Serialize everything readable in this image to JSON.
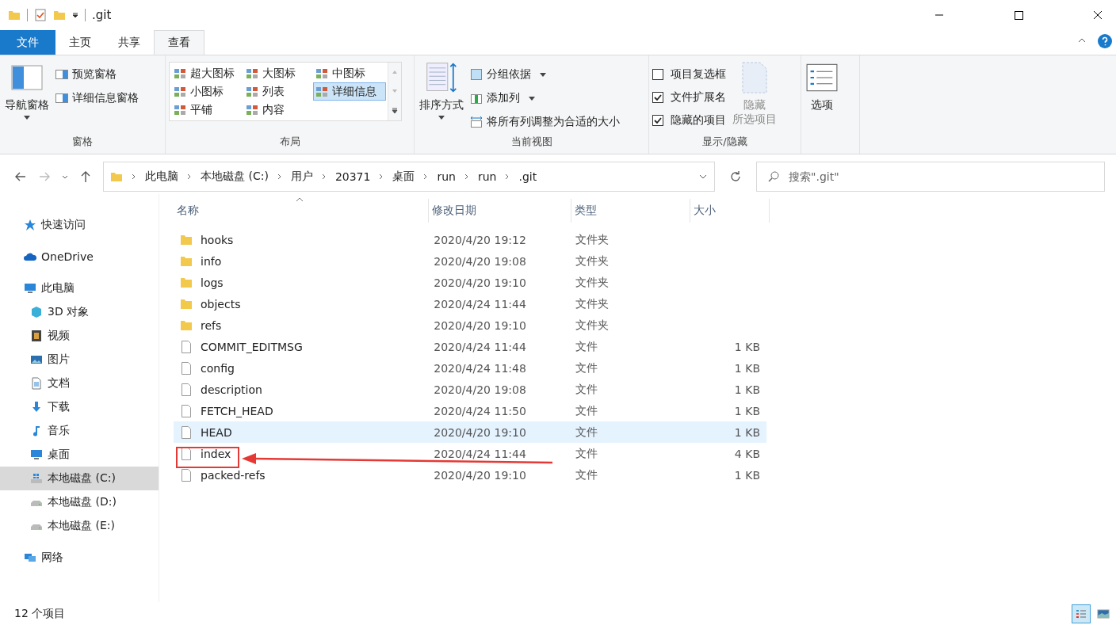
{
  "title_bar": {
    "title": ".git"
  },
  "ribbon_tabs": [
    {
      "label": "文件",
      "kind": "file",
      "selected": false
    },
    {
      "label": "主页",
      "kind": "tab",
      "selected": false
    },
    {
      "label": "共享",
      "kind": "tab",
      "selected": false
    },
    {
      "label": "查看",
      "kind": "tab",
      "selected": true
    }
  ],
  "panes": {
    "label": "窗格",
    "navigation": "导航窗格",
    "items": [
      "预览窗格",
      "详细信息窗格"
    ]
  },
  "layout": {
    "label": "布局",
    "options": [
      {
        "label": "超大图标",
        "selected": false
      },
      {
        "label": "大图标",
        "selected": false
      },
      {
        "label": "中图标",
        "selected": false
      },
      {
        "label": "小图标",
        "selected": false
      },
      {
        "label": "列表",
        "selected": false
      },
      {
        "label": "详细信息",
        "selected": true
      },
      {
        "label": "平铺",
        "selected": false
      },
      {
        "label": "内容",
        "selected": false
      }
    ]
  },
  "current_view": {
    "label": "当前视图",
    "sort": "排序方式",
    "group_by": "分组依据",
    "add_column": "添加列",
    "fit": "将所有列调整为合适的大小"
  },
  "show_hide": {
    "label": "显示/隐藏",
    "checkboxes": [
      {
        "label": "项目复选框",
        "checked": false
      },
      {
        "label": "文件扩展名",
        "checked": true
      },
      {
        "label": "隐藏的项目",
        "checked": true
      }
    ],
    "hide_selected": [
      "隐藏",
      "所选项目"
    ]
  },
  "options": "选项",
  "address": {
    "crumbs": [
      "此电脑",
      "本地磁盘 (C:)",
      "用户",
      "20371",
      "桌面",
      "run",
      "run",
      ".git"
    ],
    "search_placeholder": "搜索\".git\""
  },
  "nav": [
    {
      "label": "快速访问",
      "kind": "star",
      "selected": false
    },
    {
      "label": "OneDrive",
      "kind": "cloud",
      "selected": false
    },
    {
      "label": "此电脑",
      "kind": "pc",
      "selected": false,
      "children": [
        {
          "label": "3D 对象",
          "kind": "cube",
          "selected": false
        },
        {
          "label": "视频",
          "kind": "video",
          "selected": false
        },
        {
          "label": "图片",
          "kind": "picture",
          "selected": false
        },
        {
          "label": "文档",
          "kind": "doc",
          "selected": false
        },
        {
          "label": "下载",
          "kind": "download",
          "selected": false
        },
        {
          "label": "音乐",
          "kind": "music",
          "selected": false
        },
        {
          "label": "桌面",
          "kind": "desktop",
          "selected": false
        },
        {
          "label": "本地磁盘 (C:)",
          "kind": "sysdrive",
          "selected": true
        },
        {
          "label": "本地磁盘 (D:)",
          "kind": "drive",
          "selected": false
        },
        {
          "label": "本地磁盘 (E:)",
          "kind": "drive",
          "selected": false
        }
      ]
    },
    {
      "label": "网络",
      "kind": "network",
      "selected": false
    }
  ],
  "table": {
    "columns": [
      "名称",
      "修改日期",
      "类型",
      "大小"
    ],
    "rows": [
      {
        "name": "hooks",
        "date": "2020/4/20 19:12",
        "type": "文件夹",
        "size": "",
        "kind": "folder",
        "selected": false
      },
      {
        "name": "info",
        "date": "2020/4/20 19:08",
        "type": "文件夹",
        "size": "",
        "kind": "folder",
        "selected": false
      },
      {
        "name": "logs",
        "date": "2020/4/20 19:10",
        "type": "文件夹",
        "size": "",
        "kind": "folder",
        "selected": false
      },
      {
        "name": "objects",
        "date": "2020/4/24 11:44",
        "type": "文件夹",
        "size": "",
        "kind": "folder",
        "selected": false
      },
      {
        "name": "refs",
        "date": "2020/4/20 19:10",
        "type": "文件夹",
        "size": "",
        "kind": "folder",
        "selected": false
      },
      {
        "name": "COMMIT_EDITMSG",
        "date": "2020/4/24 11:44",
        "type": "文件",
        "size": "1 KB",
        "kind": "file",
        "selected": false
      },
      {
        "name": "config",
        "date": "2020/4/24 11:48",
        "type": "文件",
        "size": "1 KB",
        "kind": "file",
        "selected": false
      },
      {
        "name": "description",
        "date": "2020/4/20 19:08",
        "type": "文件",
        "size": "1 KB",
        "kind": "file",
        "selected": false
      },
      {
        "name": "FETCH_HEAD",
        "date": "2020/4/24 11:50",
        "type": "文件",
        "size": "1 KB",
        "kind": "file",
        "selected": false
      },
      {
        "name": "HEAD",
        "date": "2020/4/20 19:10",
        "type": "文件",
        "size": "1 KB",
        "kind": "file",
        "selected": true
      },
      {
        "name": "index",
        "date": "2020/4/24 11:44",
        "type": "文件",
        "size": "4 KB",
        "kind": "file",
        "selected": false
      },
      {
        "name": "packed-refs",
        "date": "2020/4/20 19:10",
        "type": "文件",
        "size": "1 KB",
        "kind": "file",
        "selected": false
      }
    ]
  },
  "status_bar": {
    "count": "12 个项目",
    "views": [
      {
        "kind": "details",
        "selected": true
      },
      {
        "kind": "large",
        "selected": false
      }
    ]
  }
}
